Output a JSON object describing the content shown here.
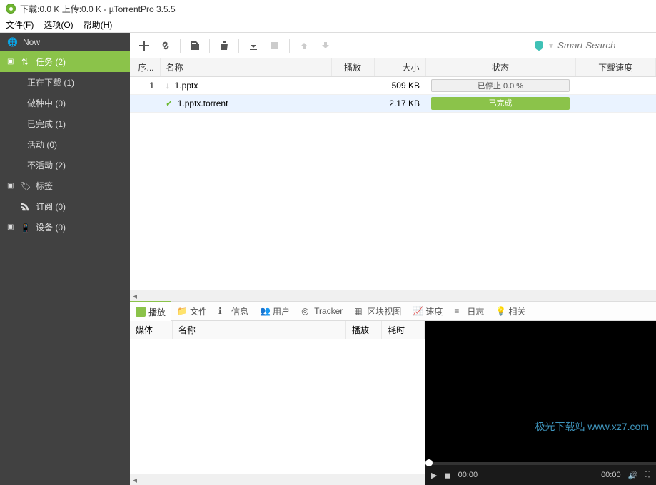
{
  "titlebar": {
    "text": "下载:0.0 K 上传:0.0 K - µTorrentPro 3.5.5"
  },
  "menu": {
    "file": "文件(F)",
    "options": "选项(O)",
    "help": "帮助(H)"
  },
  "sidebar": {
    "now": "Now",
    "tasks": "任务 (2)",
    "downloading": "正在下载 (1)",
    "seeding": "做种中 (0)",
    "completed": "已完成 (1)",
    "active": "活动 (0)",
    "inactive": "不活动 (2)",
    "labels": "标签",
    "feeds": "订阅 (0)",
    "devices": "设备 (0)"
  },
  "toolbar": {
    "search_placeholder": "Smart Search"
  },
  "columns": {
    "num": "序...",
    "name": "名称",
    "play": "播放",
    "size": "大小",
    "status": "状态",
    "dlspeed": "下载速度"
  },
  "rows": [
    {
      "num": "1",
      "icon": "down",
      "name": "1.pptx",
      "size": "509 KB",
      "status": "已停止 0.0 %",
      "status_type": "stopped"
    },
    {
      "num": "",
      "icon": "check",
      "name": "1.pptx.torrent",
      "size": "2.17 KB",
      "status": "已完成",
      "status_type": "done"
    }
  ],
  "tabs": {
    "play": "播放",
    "files": "文件",
    "info": "信息",
    "peers": "用户",
    "tracker": "Tracker",
    "pieces": "区块视图",
    "speed": "速度",
    "log": "日志",
    "related": "相关"
  },
  "mini_cols": {
    "media": "媒体",
    "name": "名称",
    "play": "播放",
    "duration": "耗时"
  },
  "player": {
    "t1": "00:00",
    "t2": "00:00"
  },
  "watermark": "极光下载站 www.xz7.com"
}
